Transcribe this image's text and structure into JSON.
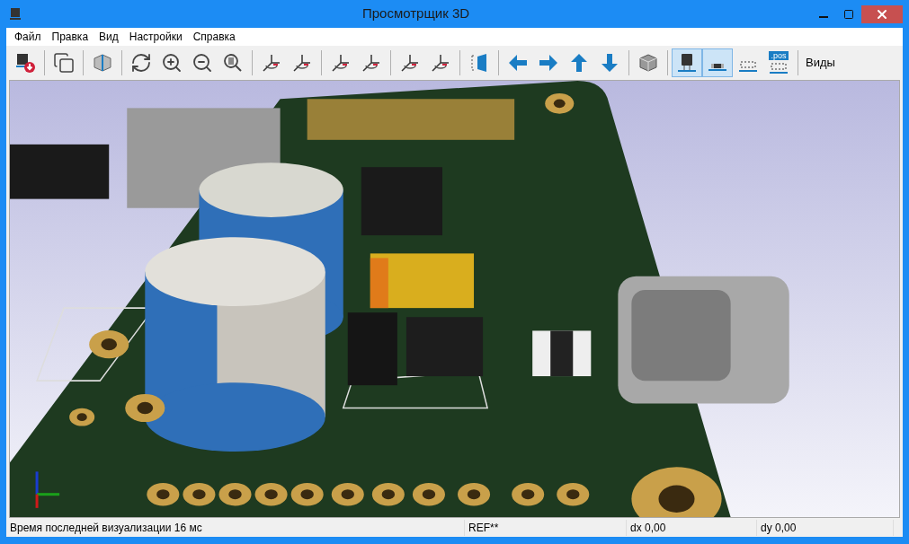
{
  "window": {
    "title": "Просмотрщик 3D"
  },
  "menu": [
    "Файл",
    "Правка",
    "Вид",
    "Настройки",
    "Справка"
  ],
  "toolbar": [
    {
      "kind": "tool"
    },
    {
      "kind": "separator"
    },
    {
      "kind": "tool"
    },
    {
      "kind": "separator"
    },
    {
      "kind": "tool"
    },
    {
      "kind": "separator"
    },
    {
      "kind": "tool"
    },
    {
      "kind": "tool"
    },
    {
      "kind": "tool"
    },
    {
      "kind": "tool"
    },
    {
      "kind": "separator"
    },
    {
      "kind": "tool"
    },
    {
      "kind": "tool"
    },
    {
      "kind": "separator"
    },
    {
      "kind": "tool"
    },
    {
      "kind": "tool"
    },
    {
      "kind": "separator"
    },
    {
      "kind": "tool"
    },
    {
      "kind": "tool"
    },
    {
      "kind": "separator"
    },
    {
      "kind": "tool"
    },
    {
      "kind": "separator"
    },
    {
      "kind": "tool"
    },
    {
      "kind": "tool"
    },
    {
      "kind": "tool"
    },
    {
      "kind": "tool"
    },
    {
      "kind": "separator"
    },
    {
      "kind": "tool"
    },
    {
      "kind": "separator"
    },
    {
      "kind": "toggle",
      "selected": true
    },
    {
      "kind": "toggle",
      "selected": true
    },
    {
      "kind": "toggle",
      "selected": false
    },
    {
      "kind": "toggle",
      "selected": false,
      "label": ".pos"
    },
    {
      "kind": "separator"
    },
    {
      "kind": "label",
      "text": "Виды"
    }
  ],
  "status_bar": [
    "Время последней визуализации 16 мс",
    "REF**",
    "dx 0,00",
    "dy 0,00"
  ]
}
